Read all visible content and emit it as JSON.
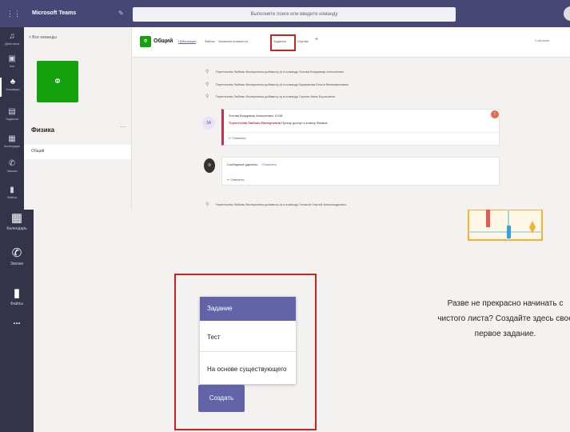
{
  "top": {
    "app_name": "Microsoft Teams",
    "search_placeholder": "Выполните поиск или введите команду",
    "rail": [
      {
        "label": "Действия",
        "icon": "bell-icon"
      },
      {
        "label": "Чат",
        "icon": "chat-icon"
      },
      {
        "label": "Команды",
        "icon": "teams-icon"
      },
      {
        "label": "Задания",
        "icon": "assignments-icon"
      },
      {
        "label": "Календарь",
        "icon": "calendar-icon"
      },
      {
        "label": "Звонки",
        "icon": "phone-icon"
      },
      {
        "label": "Файлы",
        "icon": "file-icon"
      }
    ],
    "back_link": "< Все команды",
    "team_initial": "Ф",
    "team_name": "Физика",
    "channel": "Общий",
    "channel_header": {
      "badge": "Ф",
      "title": "Общий",
      "tabs": [
        "Публикации",
        "Файлы",
        "Записная книжка кл...",
        "Задания",
        "Оценки"
      ],
      "add_tab": "+",
      "right_label": "Собрание"
    },
    "system_messages": [
      "Терентьева Любовь Валерьевна добавил(-а) в команду Зотова Владимир Алексеевич.",
      "Терентьева Любовь Валерьевна добавил(-а) в команду Бурмакова Елена Вениаминовна.",
      "Терентьева Любовь Валерьевна добавил(-а) в команду Горина Анна Борисовна."
    ],
    "post": {
      "avatar_initials": "ЗА",
      "author": "Зотова Владимир Алексеевич 10:08",
      "mention": "Терентьева Любовь Валерьевна",
      "body": "Прошу доступ к классу Физика",
      "reply": "↩ Ответить",
      "mark": "!"
    },
    "post2": {
      "avatar": "Ф",
      "title": "Сообщение удалено.",
      "undo": "Отменить",
      "reply": "↩ Ответить"
    },
    "last_system_message": "Терентьева Любовь Валерьевна добавил(-а) в команду Голиков Сергей Александрович."
  },
  "bottom": {
    "rail": [
      {
        "label": "Календарь",
        "icon": "calendar-icon"
      },
      {
        "label": "Звонки",
        "icon": "phone-icon"
      },
      {
        "label": "Файлы",
        "icon": "file-icon"
      }
    ],
    "more": "...",
    "menu_items": [
      "Задание",
      "Тест",
      "На основе существующего"
    ],
    "create_button": "Создать",
    "empty_state_line1": "Разве не прекрасно начинать с",
    "empty_state_line2": "чистого листа? Создайте здесь свое",
    "empty_state_line3": "первое задание.",
    "accent": "#6264a7",
    "highlight": "#cc2222"
  }
}
